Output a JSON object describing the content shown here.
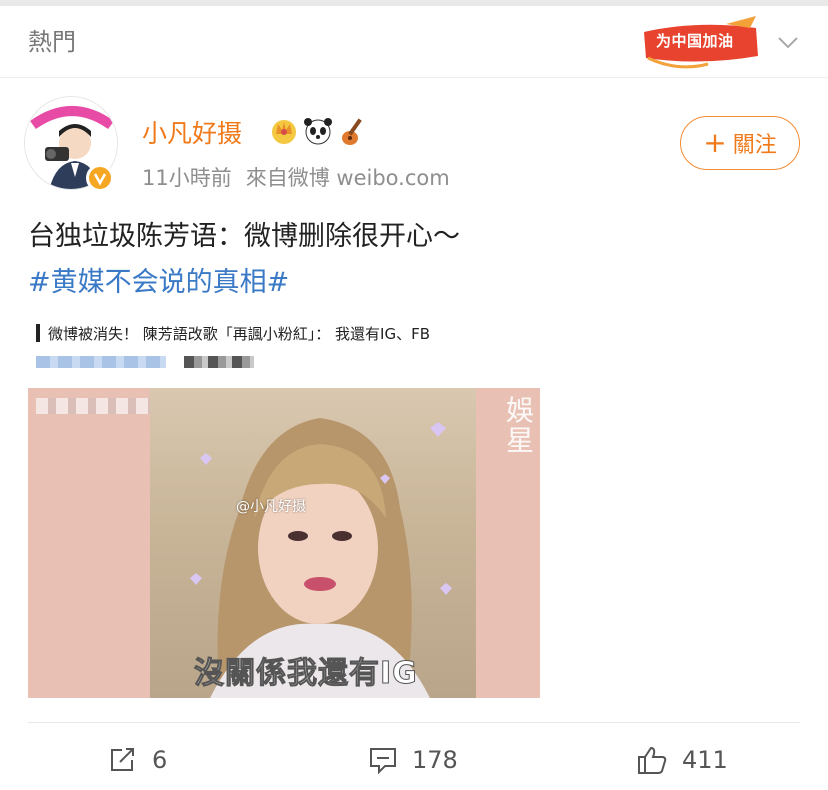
{
  "header": {
    "title": "熱門",
    "campaign_badge": "为中国加油"
  },
  "post": {
    "username": "小凡好摄",
    "time": "11小時前",
    "source": "來自微博 weibo.com",
    "follow_label": "關注",
    "text": "台独垃圾陈芳语：微博删除很开心～",
    "hashtag": "#黄媒不会说的真相#",
    "quote": "微博被消失！ 陳芳語改歌「再諷小粉紅」： 我還有IG、FB",
    "media": {
      "side_text": "娛 星",
      "watermark": "@小凡好摄",
      "subtitle": "沒關係我還有IG"
    }
  },
  "actions": {
    "reposts": "6",
    "comments": "178",
    "likes": "411"
  },
  "colors": {
    "username": "#f07a1a",
    "hashtag": "#3a79c6",
    "follow_border": "#f28c35",
    "badge": "#e8432e"
  },
  "icons": [
    "crown-emoji-icon",
    "panda-emoji-icon",
    "guitar-emoji-icon",
    "repost-icon",
    "comment-icon",
    "like-icon",
    "chevron-down-icon",
    "verified-icon"
  ]
}
